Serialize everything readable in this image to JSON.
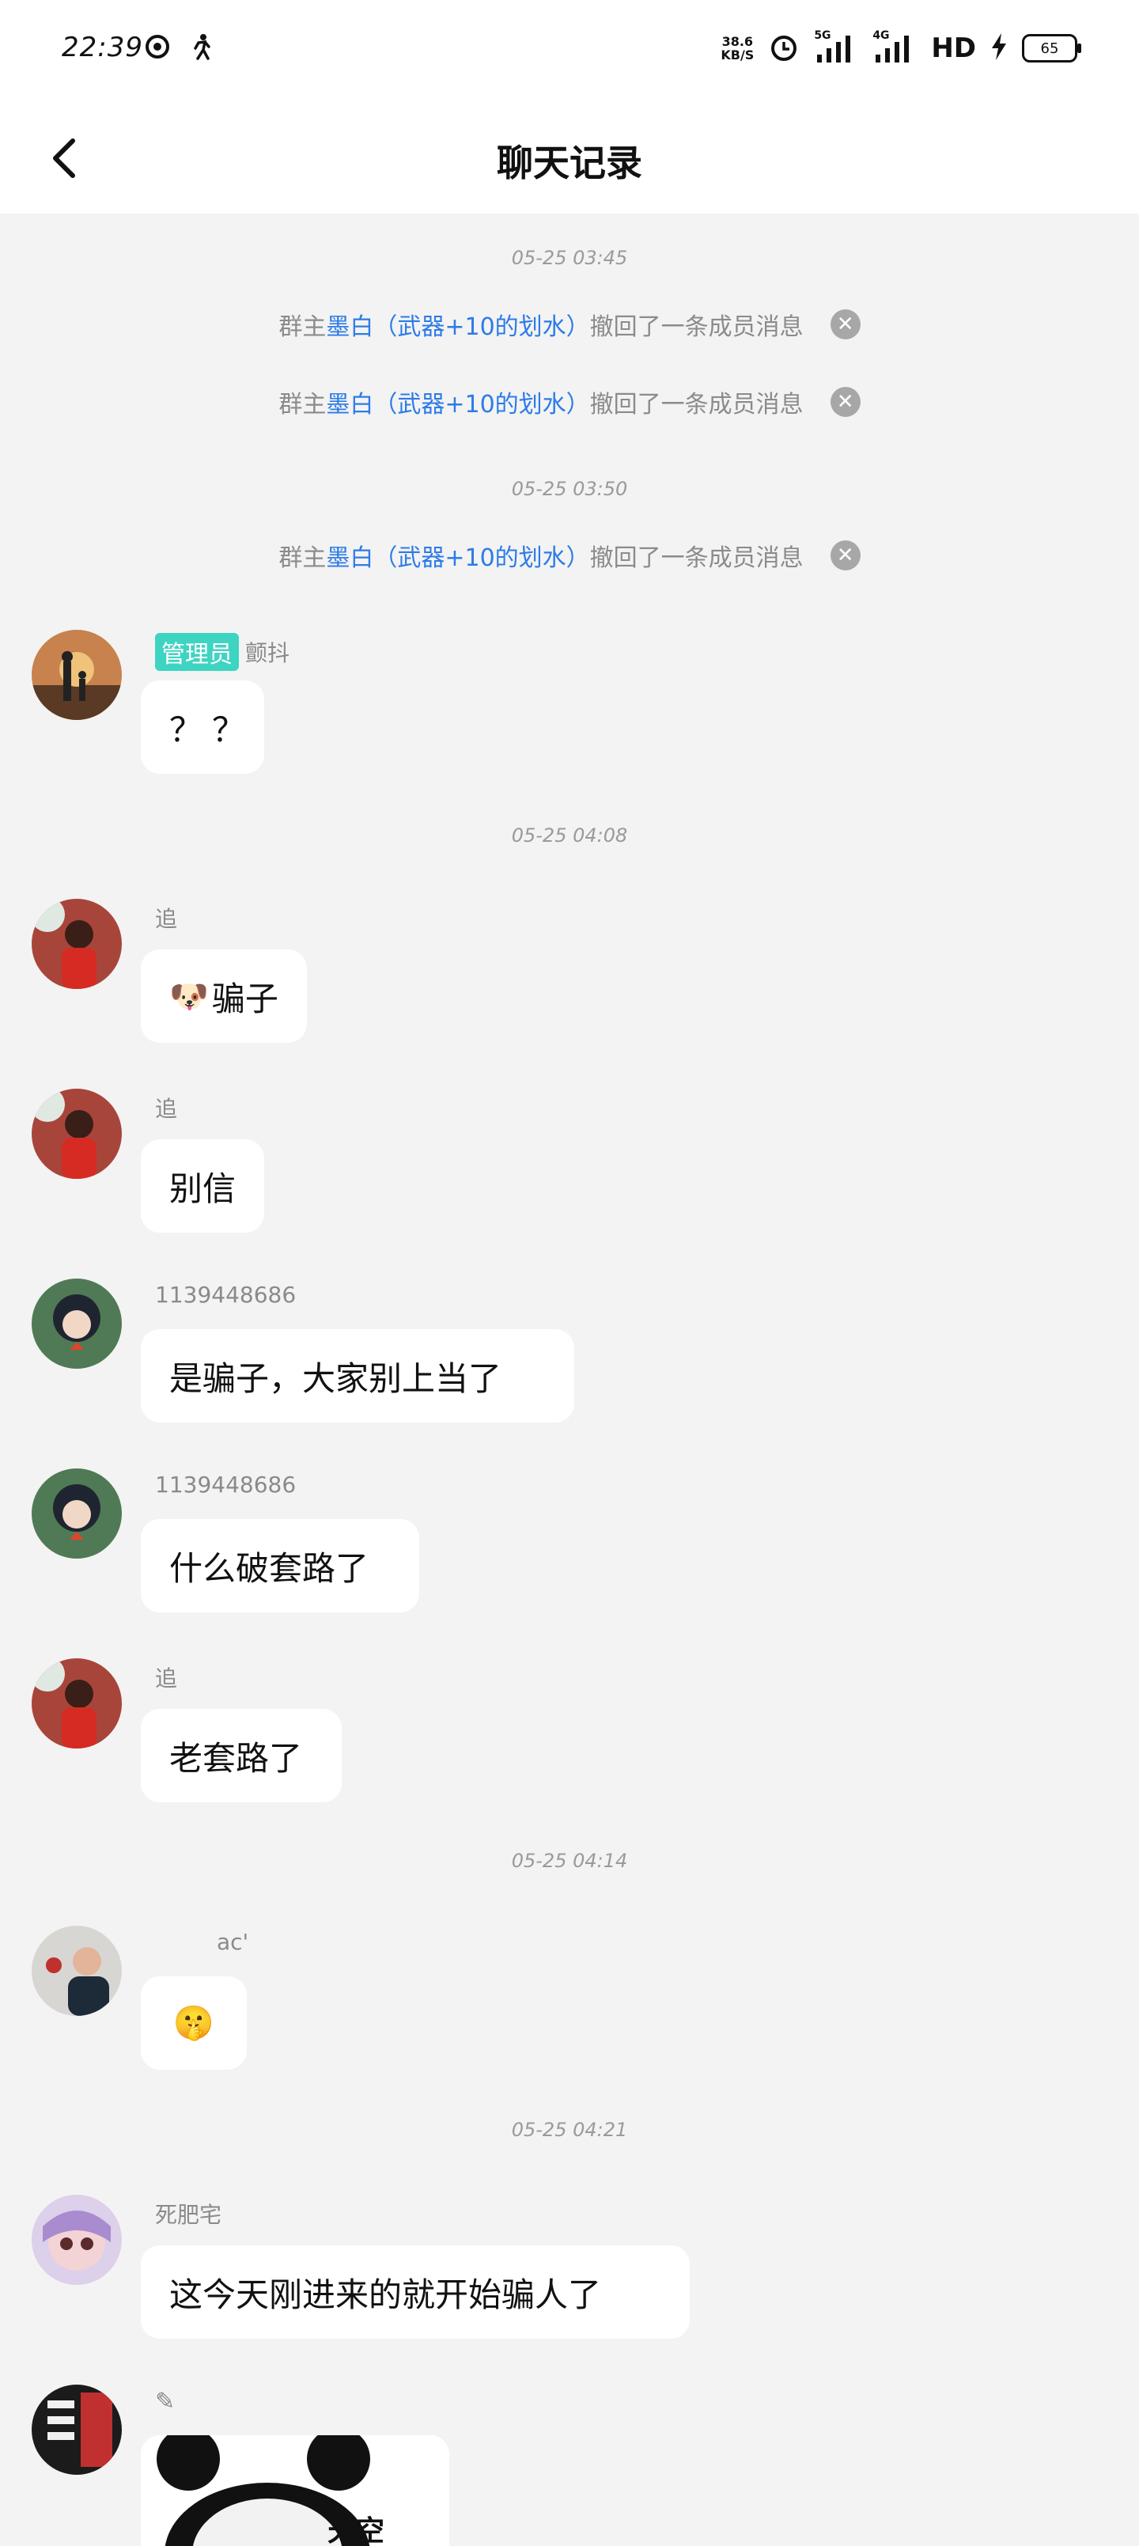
{
  "status": {
    "time": "22:39",
    "net_speed_value": "38.6",
    "net_speed_unit": "KB/S",
    "signal1_label": "5G",
    "signal2_label": "4G",
    "hd_label": "HD",
    "battery": "65"
  },
  "nav": {
    "title": "聊天记录"
  },
  "timestamps": [
    "05-25 03:45",
    "05-25 03:50",
    "05-25 04:08",
    "05-25 04:14",
    "05-25 04:21"
  ],
  "notices": [
    {
      "prefix": "群主",
      "who": "墨白（武器+10的划水）",
      "action": "撤回了一条成员消息"
    },
    {
      "prefix": "群主",
      "who": "墨白（武器+10的划水）",
      "action": "撤回了一条成员消息"
    },
    {
      "prefix": "群主",
      "who": "墨白（武器+10的划水）",
      "action": "撤回了一条成员消息"
    }
  ],
  "messages": [
    {
      "badge": "管理员",
      "sender": "颤抖",
      "text": "？？"
    },
    {
      "sender": "追",
      "emoji": "🐶",
      "text": "骗子"
    },
    {
      "sender": "追",
      "text": "别信"
    },
    {
      "sender": "1139448686",
      "text": "是骗子，大家别上当了"
    },
    {
      "sender": "1139448686",
      "text": "什么破套路了"
    },
    {
      "sender": "追",
      "text": "老套路了"
    },
    {
      "sender": "ac'",
      "text": "🤫"
    },
    {
      "sender": "死肥宅",
      "text": "这今天刚进来的就开始骗人了"
    },
    {
      "sender": "",
      "image_caption": "天空"
    }
  ],
  "colors": {
    "accent": "#2d7be8",
    "badge": "#3ed4c2"
  }
}
